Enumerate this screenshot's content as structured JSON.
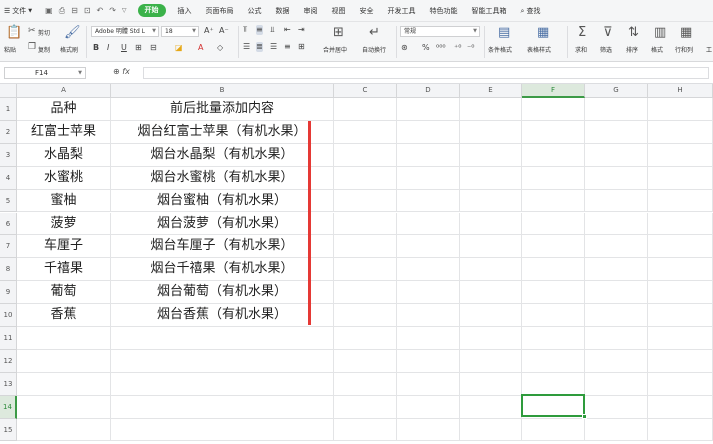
{
  "menu": {
    "file": "文件",
    "tabs": [
      "开始",
      "插入",
      "页面布局",
      "公式",
      "数据",
      "审阅",
      "视图",
      "安全",
      "开发工具",
      "特色功能",
      "智能工具箱"
    ],
    "search": "查找"
  },
  "ribbon": {
    "paste": "粘贴",
    "cut": "剪切",
    "copy": "复制",
    "format_painter": "格式刷",
    "font_name": "Adobe 明體 Std L",
    "font_size": "18",
    "bold": "B",
    "italic": "I",
    "underline": "U",
    "merge_center": "合并居中",
    "wrap": "自动换行",
    "number_format": "常规",
    "cond_format": "条件格式",
    "table_style": "表格样式",
    "sum": "求和",
    "filter": "筛选",
    "sort": "排序",
    "format": "格式",
    "row_col": "行和列",
    "work": "工"
  },
  "formula_bar": {
    "name_box": "F14",
    "fx": "fx",
    "value": ""
  },
  "grid": {
    "columns": [
      "A",
      "B",
      "C",
      "D",
      "E",
      "F",
      "G",
      "H"
    ],
    "rows": [
      "1",
      "2",
      "3",
      "4",
      "5",
      "6",
      "7",
      "8",
      "9",
      "10",
      "11",
      "12",
      "13",
      "14",
      "15"
    ],
    "selected_column": "F",
    "selected_row": "14",
    "data": [
      [
        "品种",
        "前后批量添加内容"
      ],
      [
        "红富士苹果",
        "烟台红富士苹果（有机水果）"
      ],
      [
        "水晶梨",
        "烟台水晶梨（有机水果）"
      ],
      [
        "水蜜桃",
        "烟台水蜜桃（有机水果）"
      ],
      [
        "蜜柚",
        "烟台蜜柚（有机水果）"
      ],
      [
        "菠萝",
        "烟台菠萝（有机水果）"
      ],
      [
        "车厘子",
        "烟台车厘子（有机水果）"
      ],
      [
        "千禧果",
        "烟台千禧果（有机水果）"
      ],
      [
        "葡萄",
        "烟台葡萄（有机水果）"
      ],
      [
        "香蕉",
        "烟台香蕉（有机水果）"
      ]
    ]
  },
  "colors": {
    "accent_green": "#3bb24a",
    "selection_green": "#2e9b3c",
    "red_marker": "#e53935"
  }
}
